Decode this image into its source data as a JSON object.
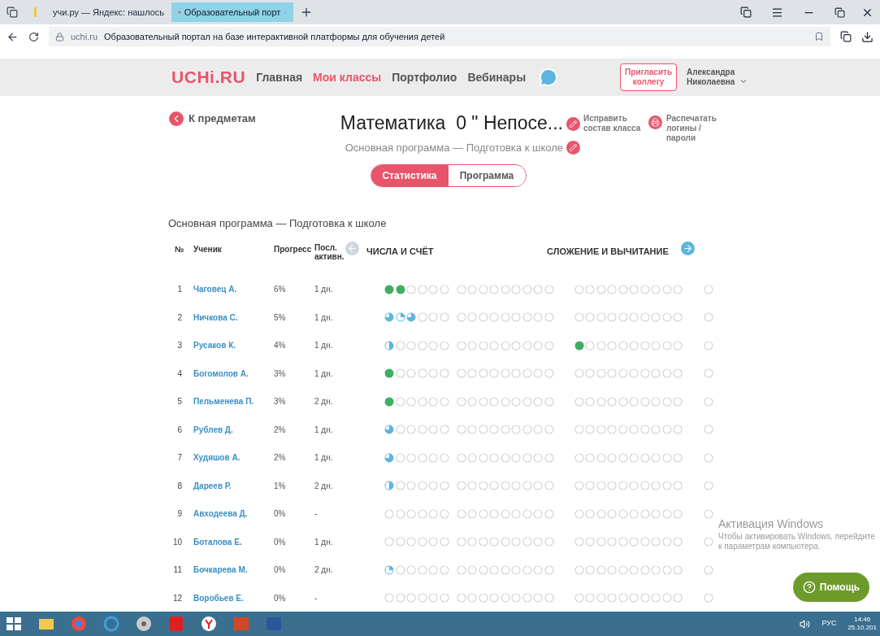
{
  "browser": {
    "tabs": [
      {
        "title": "учи.ру — Яндекс: нашлось",
        "selected": false
      },
      {
        "title": "Образовательный порт",
        "selected": true
      }
    ],
    "address": {
      "domain": "uchi.ru",
      "page_title": "Образовательный портал на базе интерактивной платформы для обучения детей"
    }
  },
  "header": {
    "logo": "UCHi.RU",
    "nav": [
      {
        "label": "Главная",
        "selected": false
      },
      {
        "label": "Мои классы",
        "selected": true
      },
      {
        "label": "Портфолио",
        "selected": false
      },
      {
        "label": "Вебинары",
        "selected": false
      }
    ],
    "invite": "Пригласить коллегу",
    "user": "Александра Николаевна"
  },
  "page": {
    "back": "К предметам",
    "title": "Математика  0 \" Непосе...",
    "subtitle": "Основная программа — Подготовка к школе",
    "actions": [
      {
        "kind": "edit",
        "label": "Исправить состав класса"
      },
      {
        "kind": "print",
        "label": "Распечатать логины / пароли"
      }
    ],
    "tabs": [
      {
        "label": "Статистика",
        "selected": true
      },
      {
        "label": "Программа",
        "selected": false
      }
    ]
  },
  "table": {
    "caption": "Основная программа — Подготовка к школе",
    "columns": [
      "№",
      "Ученик",
      "Прогресс",
      "Посл. активн."
    ],
    "topics": [
      "ЧИСЛА И СЧЁТ",
      "СЛОЖЕНИЕ И ВЫЧИТАНИЕ"
    ],
    "rows": [
      {
        "num": "1",
        "name": "Чаговец А.",
        "progress": "6%",
        "last": "1 дн.",
        "groups": [
          [
            {
              "kind": "full"
            },
            {
              "kind": "full"
            },
            {
              "kind": "empty"
            },
            {
              "kind": "empty"
            },
            {
              "kind": "empty"
            },
            {
              "kind": "empty"
            }
          ],
          [
            {
              "kind": "empty"
            },
            {
              "kind": "empty"
            },
            {
              "kind": "empty"
            },
            {
              "kind": "empty"
            },
            {
              "kind": "empty"
            },
            {
              "kind": "empty"
            },
            {
              "kind": "empty"
            },
            {
              "kind": "empty"
            },
            {
              "kind": "empty"
            }
          ],
          [
            {
              "kind": "empty"
            },
            {
              "kind": "empty"
            },
            {
              "kind": "empty"
            },
            {
              "kind": "empty"
            },
            {
              "kind": "empty"
            },
            {
              "kind": "empty"
            },
            {
              "kind": "empty"
            },
            {
              "kind": "empty"
            },
            {
              "kind": "empty"
            },
            {
              "kind": "empty"
            }
          ],
          [
            {
              "kind": "empty"
            }
          ]
        ]
      },
      {
        "num": "2",
        "name": "Ничкова С.",
        "progress": "5%",
        "last": "1 дн.",
        "groups": [
          [
            {
              "kind": "threequarter"
            },
            {
              "kind": "quarter"
            },
            {
              "kind": "threequarter"
            },
            {
              "kind": "empty"
            },
            {
              "kind": "empty"
            },
            {
              "kind": "empty"
            }
          ],
          [
            {
              "kind": "empty"
            },
            {
              "kind": "empty"
            },
            {
              "kind": "empty"
            },
            {
              "kind": "empty"
            },
            {
              "kind": "empty"
            },
            {
              "kind": "empty"
            },
            {
              "kind": "empty"
            },
            {
              "kind": "empty"
            },
            {
              "kind": "empty"
            }
          ],
          [
            {
              "kind": "empty"
            },
            {
              "kind": "empty"
            },
            {
              "kind": "empty"
            },
            {
              "kind": "empty"
            },
            {
              "kind": "empty"
            },
            {
              "kind": "empty"
            },
            {
              "kind": "empty"
            },
            {
              "kind": "empty"
            },
            {
              "kind": "empty"
            },
            {
              "kind": "empty"
            }
          ],
          [
            {
              "kind": "empty"
            }
          ]
        ]
      },
      {
        "num": "3",
        "name": "Русаков К.",
        "progress": "4%",
        "last": "1 дн.",
        "groups": [
          [
            {
              "kind": "half"
            },
            {
              "kind": "empty"
            },
            {
              "kind": "empty"
            },
            {
              "kind": "empty"
            },
            {
              "kind": "empty"
            },
            {
              "kind": "empty"
            }
          ],
          [
            {
              "kind": "empty"
            },
            {
              "kind": "empty"
            },
            {
              "kind": "empty"
            },
            {
              "kind": "empty"
            },
            {
              "kind": "empty"
            },
            {
              "kind": "empty"
            },
            {
              "kind": "empty"
            },
            {
              "kind": "empty"
            },
            {
              "kind": "empty"
            }
          ],
          [
            {
              "kind": "full"
            },
            {
              "kind": "empty"
            },
            {
              "kind": "empty"
            },
            {
              "kind": "empty"
            },
            {
              "kind": "empty"
            },
            {
              "kind": "empty"
            },
            {
              "kind": "empty"
            },
            {
              "kind": "empty"
            },
            {
              "kind": "empty"
            },
            {
              "kind": "empty"
            }
          ],
          [
            {
              "kind": "empty"
            }
          ]
        ]
      },
      {
        "num": "4",
        "name": "Богомолов А.",
        "progress": "3%",
        "last": "1 дн.",
        "groups": [
          [
            {
              "kind": "full"
            },
            {
              "kind": "empty"
            },
            {
              "kind": "empty"
            },
            {
              "kind": "empty"
            },
            {
              "kind": "empty"
            },
            {
              "kind": "empty"
            }
          ],
          [
            {
              "kind": "empty"
            },
            {
              "kind": "empty"
            },
            {
              "kind": "empty"
            },
            {
              "kind": "empty"
            },
            {
              "kind": "empty"
            },
            {
              "kind": "empty"
            },
            {
              "kind": "empty"
            },
            {
              "kind": "empty"
            },
            {
              "kind": "empty"
            }
          ],
          [
            {
              "kind": "empty"
            },
            {
              "kind": "empty"
            },
            {
              "kind": "empty"
            },
            {
              "kind": "empty"
            },
            {
              "kind": "empty"
            },
            {
              "kind": "empty"
            },
            {
              "kind": "empty"
            },
            {
              "kind": "empty"
            },
            {
              "kind": "empty"
            },
            {
              "kind": "empty"
            }
          ],
          [
            {
              "kind": "empty"
            }
          ]
        ]
      },
      {
        "num": "5",
        "name": "Пельменева П.",
        "progress": "3%",
        "last": "2 дн.",
        "groups": [
          [
            {
              "kind": "full"
            },
            {
              "kind": "empty"
            },
            {
              "kind": "empty"
            },
            {
              "kind": "empty"
            },
            {
              "kind": "empty"
            },
            {
              "kind": "empty"
            }
          ],
          [
            {
              "kind": "empty"
            },
            {
              "kind": "empty"
            },
            {
              "kind": "empty"
            },
            {
              "kind": "empty"
            },
            {
              "kind": "empty"
            },
            {
              "kind": "empty"
            },
            {
              "kind": "empty"
            },
            {
              "kind": "empty"
            },
            {
              "kind": "empty"
            }
          ],
          [
            {
              "kind": "empty"
            },
            {
              "kind": "empty"
            },
            {
              "kind": "empty"
            },
            {
              "kind": "empty"
            },
            {
              "kind": "empty"
            },
            {
              "kind": "empty"
            },
            {
              "kind": "empty"
            },
            {
              "kind": "empty"
            },
            {
              "kind": "empty"
            },
            {
              "kind": "empty"
            }
          ],
          [
            {
              "kind": "empty"
            }
          ]
        ]
      },
      {
        "num": "6",
        "name": "Рублев Д.",
        "progress": "2%",
        "last": "1 дн.",
        "groups": [
          [
            {
              "kind": "threequarter"
            },
            {
              "kind": "empty"
            },
            {
              "kind": "empty"
            },
            {
              "kind": "empty"
            },
            {
              "kind": "empty"
            },
            {
              "kind": "empty"
            }
          ],
          [
            {
              "kind": "empty"
            },
            {
              "kind": "empty"
            },
            {
              "kind": "empty"
            },
            {
              "kind": "empty"
            },
            {
              "kind": "empty"
            },
            {
              "kind": "empty"
            },
            {
              "kind": "empty"
            },
            {
              "kind": "empty"
            },
            {
              "kind": "empty"
            }
          ],
          [
            {
              "kind": "empty"
            },
            {
              "kind": "empty"
            },
            {
              "kind": "empty"
            },
            {
              "kind": "empty"
            },
            {
              "kind": "empty"
            },
            {
              "kind": "empty"
            },
            {
              "kind": "empty"
            },
            {
              "kind": "empty"
            },
            {
              "kind": "empty"
            },
            {
              "kind": "empty"
            }
          ],
          [
            {
              "kind": "empty"
            }
          ]
        ]
      },
      {
        "num": "7",
        "name": "Худяшов А.",
        "progress": "2%",
        "last": "1 дн.",
        "groups": [
          [
            {
              "kind": "threequarter"
            },
            {
              "kind": "empty"
            },
            {
              "kind": "empty"
            },
            {
              "kind": "empty"
            },
            {
              "kind": "empty"
            },
            {
              "kind": "empty"
            }
          ],
          [
            {
              "kind": "empty"
            },
            {
              "kind": "empty"
            },
            {
              "kind": "empty"
            },
            {
              "kind": "empty"
            },
            {
              "kind": "empty"
            },
            {
              "kind": "empty"
            },
            {
              "kind": "empty"
            },
            {
              "kind": "empty"
            },
            {
              "kind": "empty"
            }
          ],
          [
            {
              "kind": "empty"
            },
            {
              "kind": "empty"
            },
            {
              "kind": "empty"
            },
            {
              "kind": "empty"
            },
            {
              "kind": "empty"
            },
            {
              "kind": "empty"
            },
            {
              "kind": "empty"
            },
            {
              "kind": "empty"
            },
            {
              "kind": "empty"
            },
            {
              "kind": "empty"
            }
          ],
          [
            {
              "kind": "empty"
            }
          ]
        ]
      },
      {
        "num": "8",
        "name": "Дареев Р.",
        "progress": "1%",
        "last": "2 дн.",
        "groups": [
          [
            {
              "kind": "half"
            },
            {
              "kind": "empty"
            },
            {
              "kind": "empty"
            },
            {
              "kind": "empty"
            },
            {
              "kind": "empty"
            },
            {
              "kind": "empty"
            }
          ],
          [
            {
              "kind": "empty"
            },
            {
              "kind": "empty"
            },
            {
              "kind": "empty"
            },
            {
              "kind": "empty"
            },
            {
              "kind": "empty"
            },
            {
              "kind": "empty"
            },
            {
              "kind": "empty"
            },
            {
              "kind": "empty"
            },
            {
              "kind": "empty"
            }
          ],
          [
            {
              "kind": "empty"
            },
            {
              "kind": "empty"
            },
            {
              "kind": "empty"
            },
            {
              "kind": "empty"
            },
            {
              "kind": "empty"
            },
            {
              "kind": "empty"
            },
            {
              "kind": "empty"
            },
            {
              "kind": "empty"
            },
            {
              "kind": "empty"
            },
            {
              "kind": "empty"
            }
          ],
          [
            {
              "kind": "empty"
            }
          ]
        ]
      },
      {
        "num": "9",
        "name": "Авходеева Д.",
        "progress": "0%",
        "last": "-",
        "groups": [
          [
            {
              "kind": "empty"
            },
            {
              "kind": "empty"
            },
            {
              "kind": "empty"
            },
            {
              "kind": "empty"
            },
            {
              "kind": "empty"
            },
            {
              "kind": "empty"
            }
          ],
          [
            {
              "kind": "empty"
            },
            {
              "kind": "empty"
            },
            {
              "kind": "empty"
            },
            {
              "kind": "empty"
            },
            {
              "kind": "empty"
            },
            {
              "kind": "empty"
            },
            {
              "kind": "empty"
            },
            {
              "kind": "empty"
            },
            {
              "kind": "empty"
            }
          ],
          [
            {
              "kind": "empty"
            },
            {
              "kind": "empty"
            },
            {
              "kind": "empty"
            },
            {
              "kind": "empty"
            },
            {
              "kind": "empty"
            },
            {
              "kind": "empty"
            },
            {
              "kind": "empty"
            },
            {
              "kind": "empty"
            },
            {
              "kind": "empty"
            },
            {
              "kind": "empty"
            }
          ],
          [
            {
              "kind": "empty"
            }
          ]
        ]
      },
      {
        "num": "10",
        "name": "Боталова Е.",
        "progress": "0%",
        "last": "1 дн.",
        "groups": [
          [
            {
              "kind": "empty"
            },
            {
              "kind": "empty"
            },
            {
              "kind": "empty"
            },
            {
              "kind": "empty"
            },
            {
              "kind": "empty"
            },
            {
              "kind": "empty"
            }
          ],
          [
            {
              "kind": "empty"
            },
            {
              "kind": "empty"
            },
            {
              "kind": "empty"
            },
            {
              "kind": "empty"
            },
            {
              "kind": "empty"
            },
            {
              "kind": "empty"
            },
            {
              "kind": "empty"
            },
            {
              "kind": "empty"
            },
            {
              "kind": "empty"
            }
          ],
          [
            {
              "kind": "empty"
            },
            {
              "kind": "empty"
            },
            {
              "kind": "empty"
            },
            {
              "kind": "empty"
            },
            {
              "kind": "empty"
            },
            {
              "kind": "empty"
            },
            {
              "kind": "empty"
            },
            {
              "kind": "empty"
            },
            {
              "kind": "empty"
            },
            {
              "kind": "empty"
            }
          ],
          [
            {
              "kind": "empty"
            }
          ]
        ]
      },
      {
        "num": "11",
        "name": "Бочкарева М.",
        "progress": "0%",
        "last": "2 дн.",
        "groups": [
          [
            {
              "kind": "quarter"
            },
            {
              "kind": "empty"
            },
            {
              "kind": "empty"
            },
            {
              "kind": "empty"
            },
            {
              "kind": "empty"
            },
            {
              "kind": "empty"
            }
          ],
          [
            {
              "kind": "empty"
            },
            {
              "kind": "empty"
            },
            {
              "kind": "empty"
            },
            {
              "kind": "empty"
            },
            {
              "kind": "empty"
            },
            {
              "kind": "empty"
            },
            {
              "kind": "empty"
            },
            {
              "kind": "empty"
            },
            {
              "kind": "empty"
            }
          ],
          [
            {
              "kind": "empty"
            },
            {
              "kind": "empty"
            },
            {
              "kind": "empty"
            },
            {
              "kind": "empty"
            },
            {
              "kind": "empty"
            },
            {
              "kind": "empty"
            },
            {
              "kind": "empty"
            },
            {
              "kind": "empty"
            },
            {
              "kind": "empty"
            },
            {
              "kind": "empty"
            }
          ],
          [
            {
              "kind": "empty"
            }
          ]
        ]
      },
      {
        "num": "12",
        "name": "Воробьев Е.",
        "progress": "0%",
        "last": "-",
        "groups": [
          [
            {
              "kind": "empty"
            },
            {
              "kind": "empty"
            },
            {
              "kind": "empty"
            },
            {
              "kind": "empty"
            },
            {
              "kind": "empty"
            },
            {
              "kind": "empty"
            }
          ],
          [
            {
              "kind": "empty"
            },
            {
              "kind": "empty"
            },
            {
              "kind": "empty"
            },
            {
              "kind": "empty"
            },
            {
              "kind": "empty"
            },
            {
              "kind": "empty"
            },
            {
              "kind": "empty"
            },
            {
              "kind": "empty"
            },
            {
              "kind": "empty"
            }
          ],
          [
            {
              "kind": "empty"
            },
            {
              "kind": "empty"
            },
            {
              "kind": "empty"
            },
            {
              "kind": "empty"
            },
            {
              "kind": "empty"
            },
            {
              "kind": "empty"
            },
            {
              "kind": "empty"
            },
            {
              "kind": "empty"
            },
            {
              "kind": "empty"
            },
            {
              "kind": "empty"
            }
          ],
          [
            {
              "kind": "empty"
            }
          ]
        ]
      }
    ]
  },
  "help": "Помощь",
  "activation": {
    "title": "Активация Windows",
    "text": "Чтобы активировать Windows, перейдите к параметрам компьютера."
  },
  "taskbar": {
    "language": "РУС",
    "time": "14:46",
    "date": "25.10.201"
  }
}
